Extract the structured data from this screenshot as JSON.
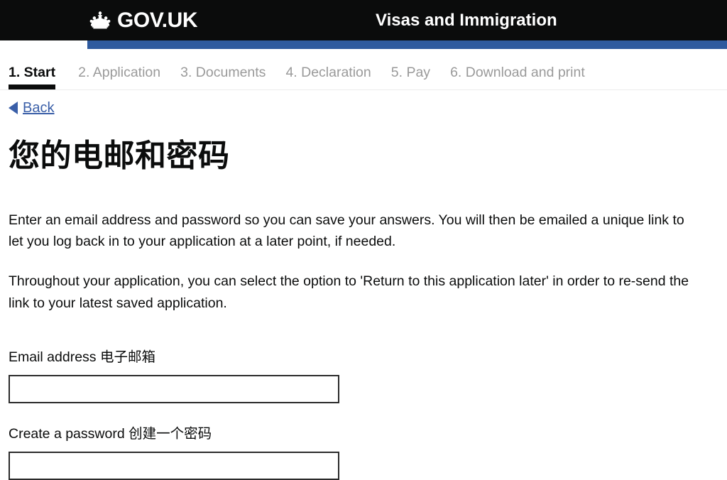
{
  "header": {
    "crown_icon": "gov-uk-crown-icon",
    "brand": "GOV.UK",
    "service_name": "Visas and Immigration",
    "background_color": "#0b0c0c",
    "accent_bar_color": "#2e5a9e"
  },
  "progress_nav": {
    "steps": [
      {
        "label": "1. Start",
        "active": true
      },
      {
        "label": "2. Application",
        "active": false
      },
      {
        "label": "3. Documents",
        "active": false
      },
      {
        "label": "4. Declaration",
        "active": false
      },
      {
        "label": "5. Pay",
        "active": false
      },
      {
        "label": "6. Download and print",
        "active": false
      }
    ],
    "active_color": "#0b0c0c",
    "inactive_color": "#9a9a9a"
  },
  "back": {
    "label": "Back",
    "icon": "arrow-left-icon",
    "link_color": "#3a5fa8"
  },
  "main": {
    "heading": "您的电邮和密码",
    "paragraphs": [
      "Enter an email address and password so you can save your answers. You will then be emailed a unique link to let you log back in to your application at a later point, if needed.",
      "Throughout your application, you can select the option to 'Return to this application later' in order to re-send the link to your latest saved application."
    ],
    "fields": [
      {
        "label": "Email address 电子邮箱",
        "value": "",
        "placeholder": ""
      },
      {
        "label": "Create a password 创建一个密码",
        "value": "",
        "placeholder": ""
      }
    ]
  }
}
